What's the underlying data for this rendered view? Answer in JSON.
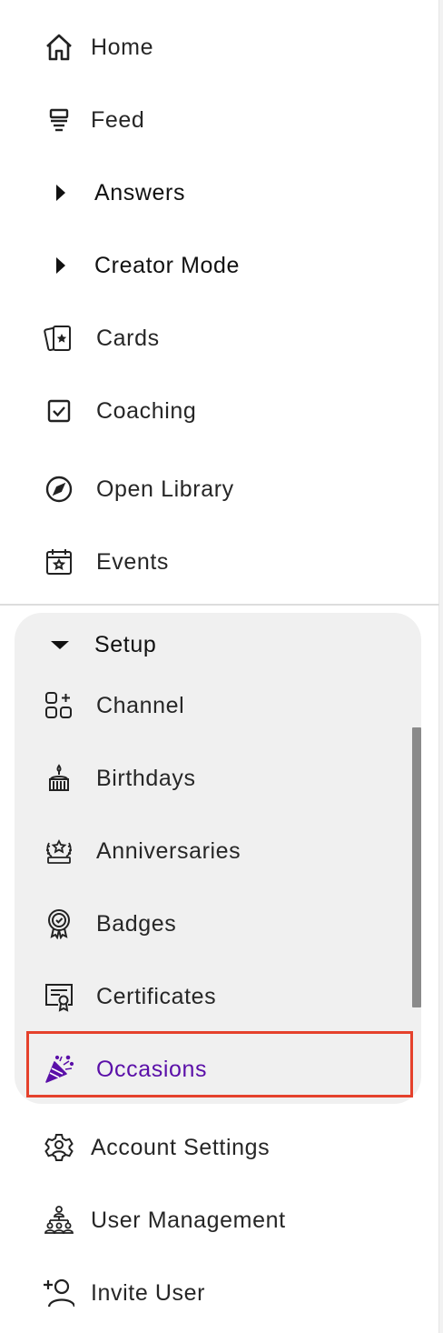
{
  "nav": {
    "home": "Home",
    "feed": "Feed",
    "answers": "Answers",
    "creator_mode": "Creator Mode",
    "cards": "Cards",
    "coaching": "Coaching",
    "open_library": "Open Library",
    "events": "Events"
  },
  "setup": {
    "title": "Setup",
    "items": {
      "channel": "Channel",
      "birthdays": "Birthdays",
      "anniversaries": "Anniversaries",
      "badges": "Badges",
      "certificates": "Certificates",
      "occasions": "Occasions"
    },
    "active_item": "Occasions"
  },
  "bottom": {
    "account_settings": "Account Settings",
    "user_management": "User Management",
    "invite_user": "Invite User"
  },
  "colors": {
    "active_text": "#5a0fa8",
    "highlight_border": "#e5412c",
    "panel_bg": "#f0f0f0"
  }
}
